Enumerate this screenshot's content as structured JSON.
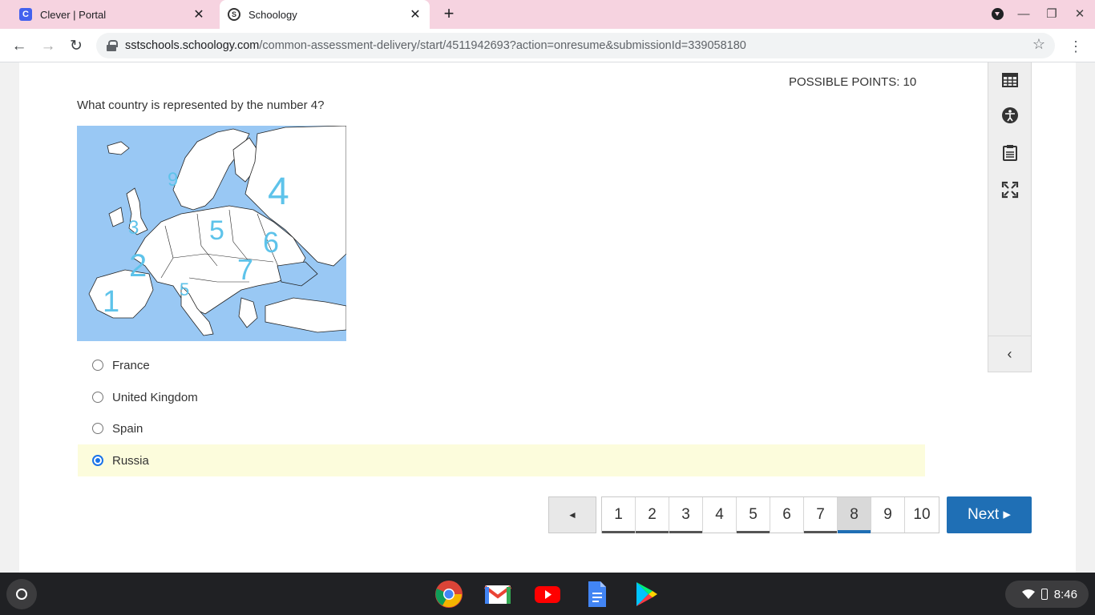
{
  "browser": {
    "tabs": [
      {
        "title": "Clever | Portal",
        "favicon": "C",
        "active": false
      },
      {
        "title": "Schoology",
        "favicon": "S",
        "active": true
      }
    ],
    "url_host": "sstschools.schoology.com",
    "url_path": "/common-assessment-delivery/start/4511942693?action=onresume&submissionId=339058180"
  },
  "assessment": {
    "possible_points": "POSSIBLE POINTS: 10",
    "question": "What country is represented by the number 4?",
    "map_labels": [
      "1",
      "2",
      "3",
      "4",
      "5",
      "5",
      "6",
      "7",
      "9"
    ],
    "choices": [
      {
        "label": "France",
        "selected": false
      },
      {
        "label": "United Kingdom",
        "selected": false
      },
      {
        "label": "Spain",
        "selected": false
      },
      {
        "label": "Russia",
        "selected": true
      }
    ],
    "prev_label": "◄",
    "pages": [
      "1",
      "2",
      "3",
      "4",
      "5",
      "6",
      "7",
      "8",
      "9",
      "10"
    ],
    "current_page": "8",
    "answered_pages": [
      "1",
      "2",
      "3",
      "5",
      "7",
      "8"
    ],
    "next_label": "Next ▸"
  },
  "sidebar": {
    "tools": [
      "calculator-icon",
      "accessibility-icon",
      "notepad-icon",
      "fullscreen-icon"
    ],
    "collapse_label": "‹"
  },
  "shelf": {
    "apps": [
      "chrome-icon",
      "gmail-icon",
      "youtube-icon",
      "docs-icon",
      "play-store-icon"
    ],
    "time": "8:46"
  },
  "colors": {
    "accent": "#1f6fb5",
    "selected_row": "#fcfcdc",
    "tab_strip": "#f6d3e0",
    "map_sea": "#99c8f4",
    "map_label": "#5ec3ea"
  }
}
